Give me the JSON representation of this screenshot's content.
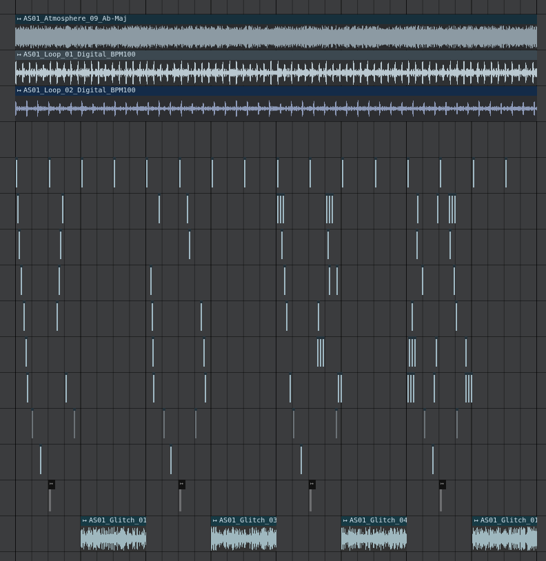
{
  "colors": {
    "background": "#3b3c3e",
    "header_dark": "#17303c",
    "header_light": "#3c4850",
    "header_blue": "#142b48",
    "body_dark": "#2a2b2d",
    "wave_light": "#9fb3bd",
    "wave_blue": "#8c99b8",
    "glitch_header": "#173a44",
    "glitch_body": "#333"
  },
  "top_clips": [
    {
      "name": "AS01_Atmosphere_09_Ab-Maj",
      "icon": "clip-arrow-icon",
      "style": "dark"
    },
    {
      "name": "AS01_Loop_01_Digital_BPM100",
      "icon": "clip-arrow-icon",
      "style": "light"
    },
    {
      "name": "AS01_Loop_02_Digital_BPM100",
      "icon": "clip-arrow-icon",
      "style": "blue"
    }
  ],
  "glitch_clips": [
    {
      "name": "AS01_Glitch_01",
      "icon": "clip-arrow-icon"
    },
    {
      "name": "AS01_Glitch_03",
      "icon": "clip-arrow-icon"
    },
    {
      "name": "AS01_Glitch_04",
      "icon": "clip-arrow-icon"
    },
    {
      "name": "AS01_Glitch_01",
      "icon": "clip-arrow-icon"
    }
  ]
}
